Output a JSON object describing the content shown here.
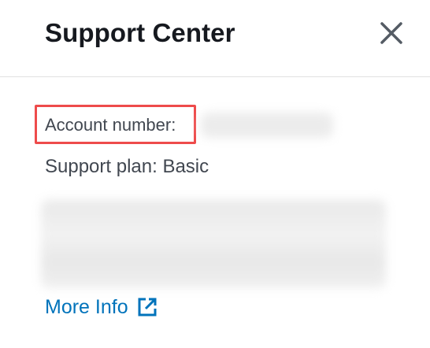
{
  "panel": {
    "title": "Support Center",
    "close_icon": "close-icon"
  },
  "account": {
    "label": "Account number:",
    "value_redacted": true
  },
  "support_plan": {
    "text": "Support plan: Basic"
  },
  "description": {
    "redacted": true
  },
  "more_info": {
    "label": "More Info",
    "icon": "external-link-icon"
  },
  "colors": {
    "highlight_box": "#ee4b4b",
    "link": "#0073bb",
    "title": "#16191f",
    "body_text": "#414750"
  }
}
